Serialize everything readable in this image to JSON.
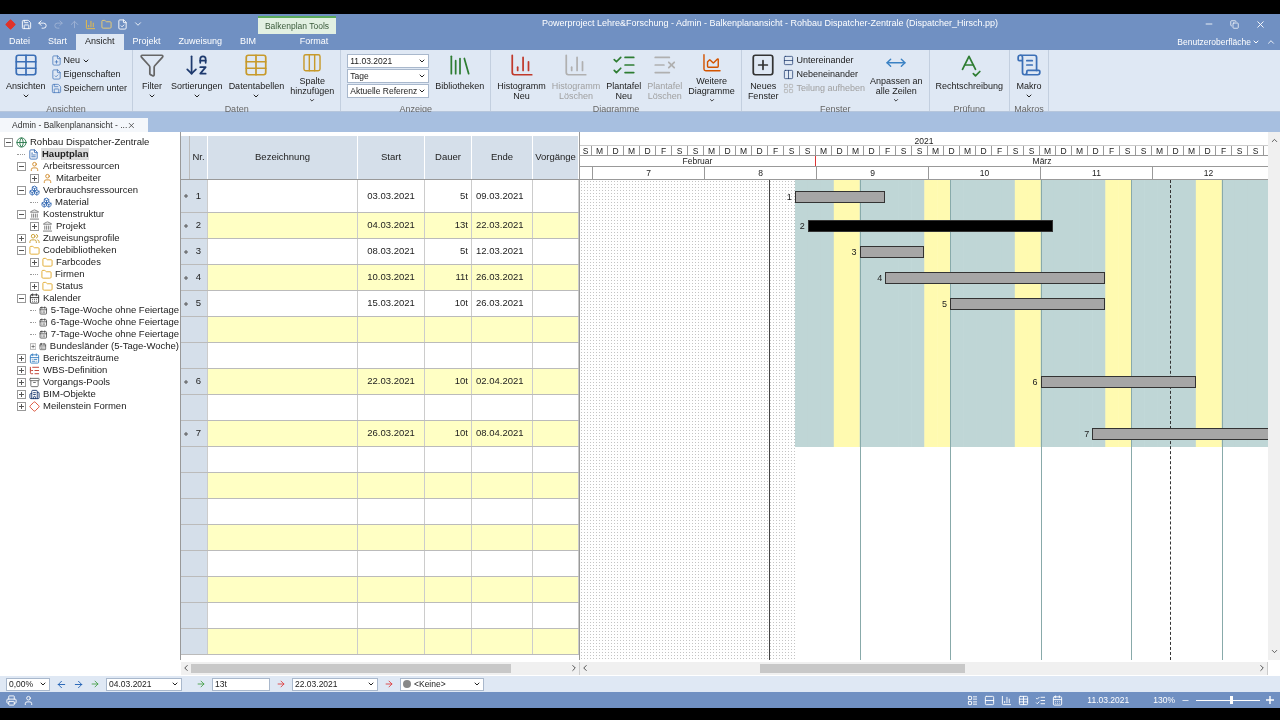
{
  "window": {
    "title": "Powerproject Lehre&Forschung - Admin - Balkenplanansicht - Rohbau Dispatcher-Zentrale (Dispatcher_Hirsch.pp)",
    "context_tab": "Balkenplan Tools"
  },
  "ribbon_tabs": [
    {
      "label": "Datei",
      "selected": false
    },
    {
      "label": "Start",
      "selected": false
    },
    {
      "label": "Ansicht",
      "selected": true
    },
    {
      "label": "Projekt",
      "selected": false
    },
    {
      "label": "Zuweisung",
      "selected": false
    },
    {
      "label": "BIM",
      "selected": false
    },
    {
      "label": "Format",
      "selected": false
    }
  ],
  "ui_menu": "Benutzeroberfläche",
  "ribbon_groups": [
    {
      "label": "Ansichten",
      "items": [
        {
          "kind": "large",
          "label": "Ansichten",
          "dropdown": true,
          "disabled": false
        },
        {
          "kind": "stack",
          "items": [
            {
              "label": "Neu",
              "dropdown": true,
              "disabled": false
            },
            {
              "label": "Eigenschaften",
              "dropdown": false,
              "disabled": false
            },
            {
              "label": "Speichern unter",
              "dropdown": false,
              "disabled": false
            }
          ]
        }
      ]
    },
    {
      "label": "Daten",
      "items": [
        {
          "kind": "large",
          "label": "Filter",
          "dropdown": true,
          "disabled": false
        },
        {
          "kind": "large",
          "label": "Sortierungen",
          "dropdown": true,
          "disabled": false
        },
        {
          "kind": "large",
          "label": "Datentabellen",
          "dropdown": true,
          "disabled": false
        },
        {
          "kind": "large",
          "label": "Spalte\nhinzufügen",
          "dropdown": true,
          "disabled": false
        }
      ]
    },
    {
      "label": "Anzeige",
      "items": [
        {
          "kind": "combos",
          "items": [
            {
              "value": "11.03.2021"
            },
            {
              "value": "Tage"
            },
            {
              "value": "Aktuelle Referenz"
            }
          ]
        },
        {
          "kind": "large",
          "label": "Bibliotheken",
          "dropdown": false,
          "disabled": false
        }
      ]
    },
    {
      "label": "Diagramme",
      "items": [
        {
          "kind": "large",
          "label": "Histogramm\nNeu",
          "dropdown": false,
          "disabled": false
        },
        {
          "kind": "large",
          "label": "Histogramm\nLöschen",
          "dropdown": false,
          "disabled": true
        },
        {
          "kind": "large",
          "label": "Plantafel\nNeu",
          "dropdown": false,
          "disabled": false
        },
        {
          "kind": "large",
          "label": "Plantafel\nLöschen",
          "dropdown": false,
          "disabled": true
        },
        {
          "kind": "large",
          "label": "Weitere\nDiagramme",
          "dropdown": true,
          "disabled": false
        }
      ]
    },
    {
      "label": "Fenster",
      "items": [
        {
          "kind": "large",
          "label": "Neues\nFenster",
          "dropdown": false,
          "disabled": false
        },
        {
          "kind": "stack",
          "items": [
            {
              "label": "Untereinander",
              "dropdown": false,
              "disabled": false
            },
            {
              "label": "Nebeneinander",
              "dropdown": false,
              "disabled": false
            },
            {
              "label": "Teilung aufheben",
              "dropdown": false,
              "disabled": true
            }
          ]
        },
        {
          "kind": "large",
          "label": "Anpassen an\nalle Zeilen",
          "dropdown": true,
          "disabled": false
        }
      ]
    },
    {
      "label": "Prüfung",
      "items": [
        {
          "kind": "large",
          "label": "Rechtschreibung",
          "dropdown": false,
          "disabled": false
        }
      ]
    },
    {
      "label": "Makros",
      "items": [
        {
          "kind": "large",
          "label": "Makro",
          "dropdown": true,
          "disabled": false
        }
      ]
    }
  ],
  "document_tab": {
    "label": "Admin - Balkenplanansicht - ..."
  },
  "tree": [
    {
      "label": "Rohbau Dispatcher-Zentrale",
      "kind": "project",
      "selected": false,
      "expanded": true,
      "children": [
        {
          "label": "Hauptplan",
          "kind": "plan",
          "selected": true
        },
        {
          "label": "Arbeitsressourcen",
          "kind": "person",
          "selected": false,
          "expanded": true,
          "children": [
            {
              "label": "Mitarbeiter",
              "kind": "person",
              "selected": false,
              "expanded": false
            }
          ]
        },
        {
          "label": "Verbrauchsressourcen",
          "kind": "material",
          "selected": false,
          "expanded": true,
          "children": [
            {
              "label": "Material",
              "kind": "material",
              "selected": false
            }
          ]
        },
        {
          "label": "Kostenstruktur",
          "kind": "bank",
          "selected": false,
          "expanded": true,
          "children": [
            {
              "label": "Projekt",
              "kind": "bank",
              "selected": false,
              "expanded": false
            }
          ]
        },
        {
          "label": "Zuweisungsprofile",
          "kind": "profile",
          "selected": false,
          "expanded": false
        },
        {
          "label": "Codebibliotheken",
          "kind": "folder",
          "selected": false,
          "expanded": true,
          "children": [
            {
              "label": "Farbcodes",
              "kind": "folder",
              "selected": false,
              "expanded": false
            },
            {
              "label": "Firmen",
              "kind": "folder",
              "selected": false
            },
            {
              "label": "Status",
              "kind": "folder",
              "selected": false,
              "expanded": false
            }
          ]
        },
        {
          "label": "Kalender",
          "kind": "calendar",
          "selected": false,
          "expanded": true,
          "children": [
            {
              "label": "5-Tage-Woche ohne Feiertage",
              "kind": "calendar",
              "selected": false
            },
            {
              "label": "6-Tage-Woche ohne Feiertage",
              "kind": "calendar",
              "selected": false
            },
            {
              "label": "7-Tage-Woche ohne Feiertage",
              "kind": "calendar",
              "selected": false
            },
            {
              "label": "Bundesländer (5-Tage-Woche)",
              "kind": "calendar",
              "selected": false,
              "expanded": false
            }
          ]
        },
        {
          "label": "Berichtszeiträume",
          "kind": "report",
          "selected": false,
          "expanded": false
        },
        {
          "label": "WBS-Definition",
          "kind": "wbs",
          "selected": false,
          "expanded": false
        },
        {
          "label": "Vorgangs-Pools",
          "kind": "pool",
          "selected": false,
          "expanded": false
        },
        {
          "label": "BIM-Objekte",
          "kind": "bim",
          "selected": false,
          "expanded": false
        },
        {
          "label": "Meilenstein Formen",
          "kind": "milestone",
          "selected": false,
          "expanded": false
        }
      ]
    }
  ],
  "table": {
    "columns": [
      "Nr.",
      "Bezeichnung",
      "Start",
      "Dauer",
      "Ende",
      "Vorgänge"
    ],
    "rows": [
      {
        "kind": "task",
        "nr": "1",
        "start": "03.03.2021",
        "duration": "5t",
        "end": "09.03.2021",
        "color": "#a6a6a6",
        "bar_label": "1"
      },
      {
        "kind": "task",
        "nr": "2",
        "start": "04.03.2021",
        "duration": "13t",
        "end": "22.03.2021",
        "color": "#000000",
        "bar_label": "2"
      },
      {
        "kind": "task",
        "nr": "3",
        "start": "08.03.2021",
        "duration": "5t",
        "end": "12.03.2021",
        "color": "#a6a6a6",
        "bar_label": "3"
      },
      {
        "kind": "task",
        "nr": "4",
        "start": "10.03.2021",
        "duration": "11t",
        "end": "26.03.2021",
        "color": "#a6a6a6",
        "bar_label": "4"
      },
      {
        "kind": "task",
        "nr": "5",
        "start": "15.03.2021",
        "duration": "10t",
        "end": "26.03.2021",
        "color": "#a6a6a6",
        "bar_label": "5"
      },
      {
        "kind": "empty"
      },
      {
        "kind": "empty"
      },
      {
        "kind": "task",
        "nr": "6",
        "start": "22.03.2021",
        "duration": "10t",
        "end": "02.04.2021",
        "color": "#a6a6a6",
        "bar_label": "6"
      },
      {
        "kind": "empty"
      },
      {
        "kind": "task",
        "nr": "7",
        "start": "26.03.2021",
        "duration": "10t",
        "end": "08.04.2021",
        "color": "#a6a6a6",
        "bar_label": "7"
      },
      {
        "kind": "empty"
      },
      {
        "kind": "empty"
      },
      {
        "kind": "empty"
      },
      {
        "kind": "empty"
      },
      {
        "kind": "empty"
      },
      {
        "kind": "empty"
      },
      {
        "kind": "empty"
      },
      {
        "kind": "empty"
      }
    ]
  },
  "timescale": {
    "year": "2021",
    "day_letters": [
      "S",
      "M",
      "D",
      "M",
      "D",
      "F",
      "S",
      "S",
      "M",
      "D",
      "M",
      "D",
      "F",
      "S",
      "S",
      "M",
      "D",
      "M",
      "D",
      "F",
      "S",
      "S",
      "M",
      "D",
      "M",
      "D",
      "F",
      "S",
      "S",
      "M",
      "D",
      "M",
      "D",
      "F",
      "S",
      "S",
      "M",
      "D",
      "M",
      "D",
      "F",
      "S",
      "S"
    ],
    "months": [
      "Februar",
      "März"
    ],
    "weeks": [
      "7",
      "8",
      "9",
      "10",
      "11",
      "12"
    ]
  },
  "bottom_toolbar": {
    "progress": "0,00%",
    "start": "04.03.2021",
    "duration": "13t",
    "end": "22.03.2021",
    "code": "<Keine>"
  },
  "status_bar": {
    "date": "11.03.2021",
    "zoom": "130%",
    "zoom_slider": {
      "level": 0.55
    }
  }
}
